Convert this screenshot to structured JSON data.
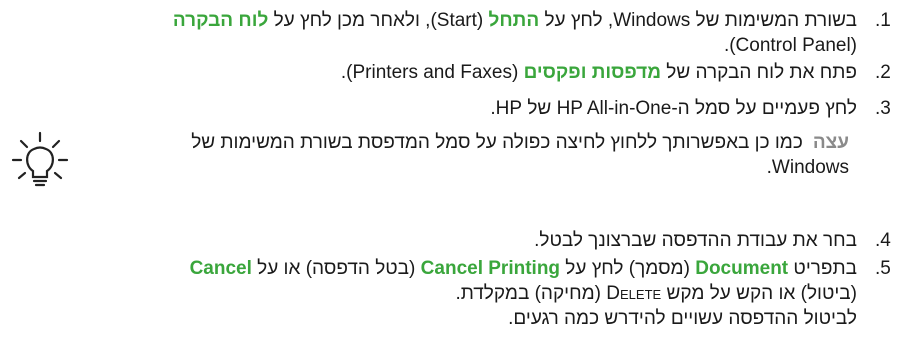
{
  "steps": [
    {
      "number": ".1",
      "line1": {
        "a": "בשורת המשימות של Windows, לחץ על ",
        "b": "התחל",
        "c": " (Start), ולאחר מכן לחץ על ",
        "d": "לוח הבקרה"
      },
      "line2": "(Control Panel)."
    },
    {
      "number": ".2",
      "a": "פתח את לוח הבקרה של ",
      "b": "מדפסות ופקסים",
      "c": " (Printers and Faxes)."
    },
    {
      "number": ".3",
      "text": "לחץ פעמיים על סמל ה-HP All-in-One של HP."
    },
    {
      "number": ".4",
      "text": "בחר את עבודת ההדפסה שברצונך לבטל."
    },
    {
      "number": ".5",
      "line1": {
        "a": "בתפריט ",
        "b": "Document",
        "c": " (מסמך) לחץ על ",
        "d": "Cancel Printing",
        "e": " (בטל הדפסה) או על ",
        "f": "Cancel"
      },
      "line2": {
        "a": "(ביטול) או הקש על מקש ",
        "key": "Delete",
        "b": " (מחיקה) במקלדת."
      },
      "line3": "לביטול ההדפסה עשויים להידרש כמה רגעים."
    }
  ],
  "tip": {
    "label": "עצה",
    "line1": "כמו כן באפשרותך ללחוץ לחיצה כפולה על סמל המדפסת בשורת המשימות של",
    "line2": "Windows."
  },
  "colors": {
    "highlight": "#3aa63c",
    "tip_label": "#8a8a8a"
  },
  "icons": {
    "tip": "lightbulb-icon"
  }
}
